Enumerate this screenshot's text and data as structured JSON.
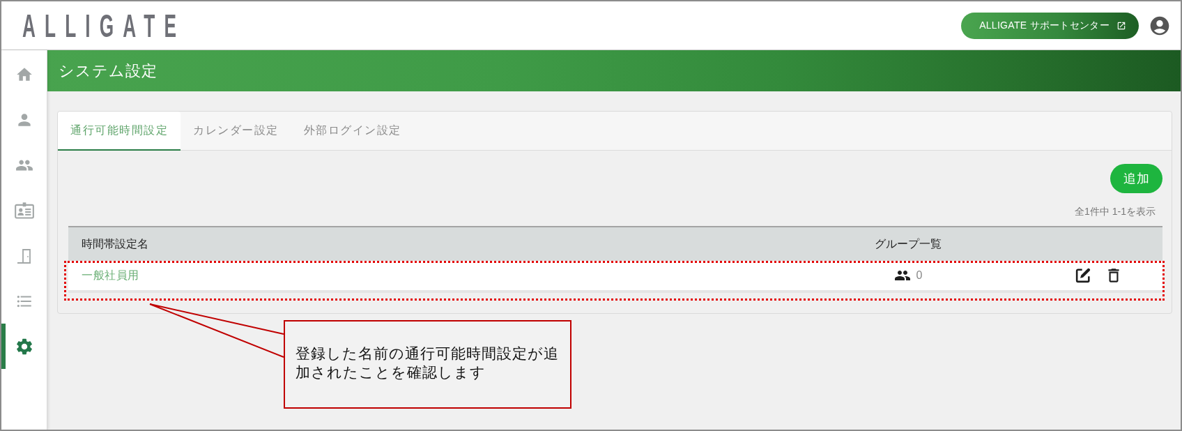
{
  "header": {
    "logo": "ALLIGATE",
    "support_button": "ALLIGATE サポートセンター"
  },
  "sidebar": {
    "items": [
      {
        "kind": "home",
        "selected": false
      },
      {
        "kind": "user",
        "selected": false
      },
      {
        "kind": "users",
        "selected": false
      },
      {
        "kind": "card",
        "selected": false
      },
      {
        "kind": "door",
        "selected": false
      },
      {
        "kind": "list",
        "selected": false
      },
      {
        "kind": "settings",
        "selected": true
      }
    ]
  },
  "page_title": "システム設定",
  "tabs": [
    {
      "label": "通行可能時間設定",
      "selected": true
    },
    {
      "label": "カレンダー設定",
      "selected": false
    },
    {
      "label": "外部ログイン設定",
      "selected": false
    }
  ],
  "toolbar": {
    "add_button": "追加",
    "pagination": "全1件中 1-1を表示"
  },
  "table": {
    "columns": [
      "時間帯設定名",
      "グループ一覧"
    ],
    "rows": [
      {
        "name": "一般社員用",
        "group_count": "0"
      }
    ]
  },
  "annotation": {
    "text": "登録した名前の通行可能時間設定が追加されたことを確認します"
  }
}
